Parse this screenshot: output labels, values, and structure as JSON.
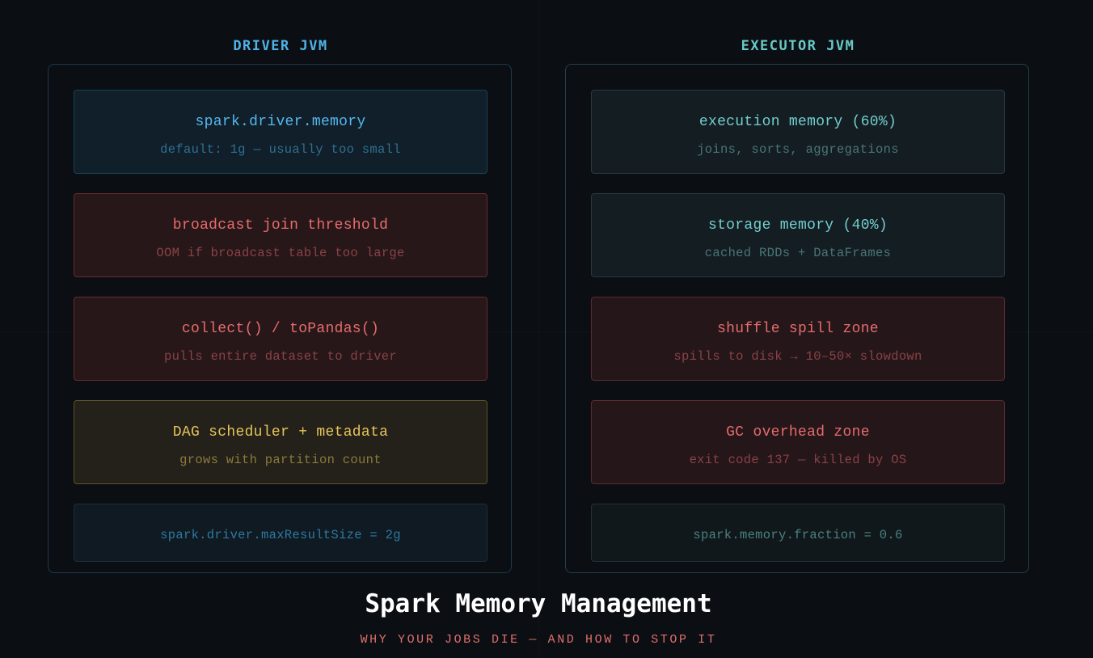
{
  "title": "Spark Memory Management",
  "subtitle": "WHY YOUR JOBS DIE — AND HOW TO STOP IT",
  "driver": {
    "heading": "DRIVER JVM",
    "boxes": [
      {
        "title": "spark.driver.memory",
        "desc": "default: 1g — usually too small",
        "tone": "info"
      },
      {
        "title": "broadcast join threshold",
        "desc": "OOM if broadcast table too large",
        "tone": "danger"
      },
      {
        "title": "collect() / toPandas()",
        "desc": "pulls entire dataset to driver",
        "tone": "danger"
      },
      {
        "title": "DAG scheduler + metadata",
        "desc": "grows with partition count",
        "tone": "warning"
      }
    ],
    "footer": "spark.driver.maxResultSize = 2g"
  },
  "executor": {
    "heading": "EXECUTOR JVM",
    "boxes": [
      {
        "title": "execution memory (60%)",
        "desc": "joins, sorts, aggregations",
        "tone": "info"
      },
      {
        "title": "storage memory (40%)",
        "desc": "cached RDDs + DataFrames",
        "tone": "info"
      },
      {
        "title": "shuffle spill zone",
        "desc": "spills to disk → 10–50× slowdown",
        "tone": "danger"
      },
      {
        "title": "GC overhead zone",
        "desc": "exit code 137 — killed by OS",
        "tone": "danger"
      }
    ],
    "footer": "spark.memory.fraction = 0.6"
  },
  "colors": {
    "background": "#0b0e13",
    "driver_accent": "#4fb3e8",
    "executor_accent": "#69c9c9",
    "danger": "#e76c6c",
    "warning": "#e7c35a",
    "title": "#ffffff",
    "subtitle": "#e0706a"
  }
}
